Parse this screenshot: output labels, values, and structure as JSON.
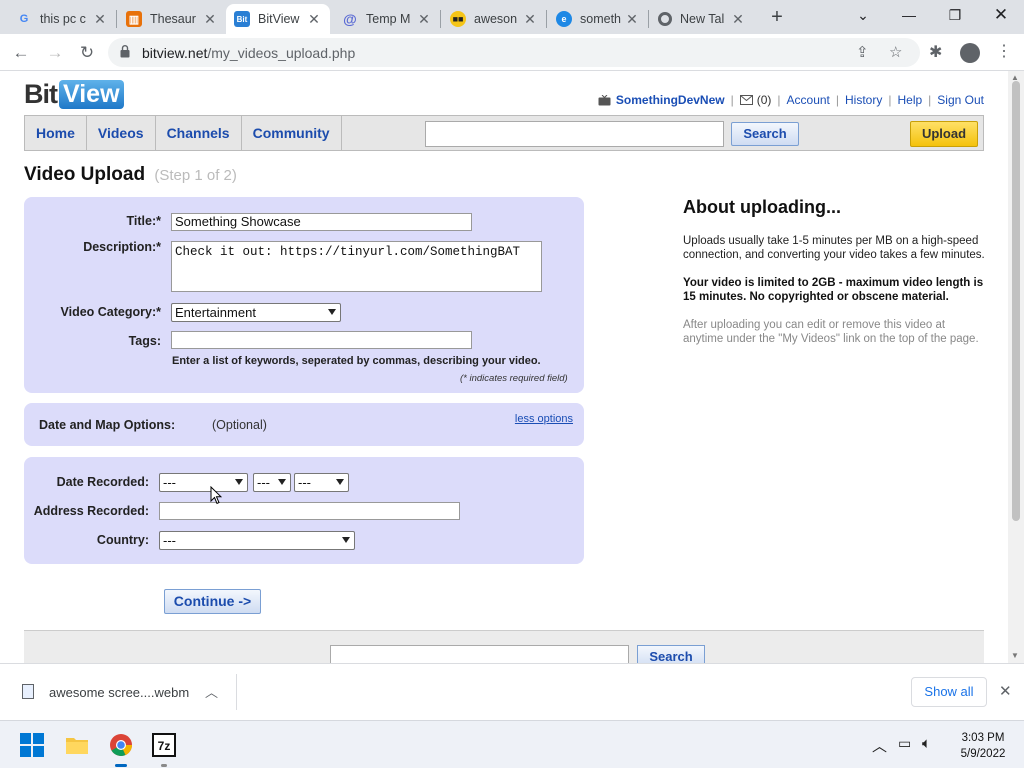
{
  "browser": {
    "tabs": [
      {
        "title": "this pc c",
        "favicon": "google-icon",
        "active": false
      },
      {
        "title": "Thesaur",
        "favicon": "book-icon",
        "active": false
      },
      {
        "title": "BitView",
        "favicon": "bitview-icon",
        "active": true
      },
      {
        "title": "Temp M",
        "favicon": "at-icon",
        "active": false
      },
      {
        "title": "aweson",
        "favicon": "sunglasses-emoji-icon",
        "active": false
      },
      {
        "title": "someth",
        "favicon": "edge-icon",
        "active": false
      },
      {
        "title": "New Tal",
        "favicon": "chrome-icon",
        "active": false
      }
    ],
    "url_host": "bitview.net",
    "url_path": "/my_videos_upload.php"
  },
  "site": {
    "logo_left": "Bit",
    "logo_right": "View",
    "user": {
      "username": "SomethingDevNew",
      "inbox_count": "(0)",
      "links": [
        "Account",
        "History",
        "Help",
        "Sign Out"
      ]
    },
    "nav": [
      "Home",
      "Videos",
      "Channels",
      "Community"
    ],
    "search_button": "Search",
    "upload_button": "Upload"
  },
  "form": {
    "page_title": "Video Upload",
    "step": "(Step 1 of 2)",
    "title_label": "Title:*",
    "title_value": "Something Showcase",
    "description_label": "Description:*",
    "description_value": "Check it out: https://tinyurl.com/SomethingBAT",
    "category_label": "Video Category:*",
    "category_value": "Entertainment",
    "tags_label": "Tags:",
    "tags_value": "",
    "tags_hint": "Enter a list of keywords, seperated by commas, describing your video.",
    "required_note": "(* indicates required field)",
    "date_map_label": "Date and Map Options:",
    "optional_text": "(Optional)",
    "less_options": "less options",
    "date_recorded_label": "Date Recorded:",
    "date_month": "---",
    "date_day": "---",
    "date_year": "---",
    "address_label": "Address Recorded:",
    "address_value": "",
    "country_label": "Country:",
    "country_value": "---",
    "continue_button": "Continue ->"
  },
  "about": {
    "heading": "About uploading...",
    "p1": "Uploads usually take 1-5 minutes per MB on a high-speed connection, and converting your video takes a few minutes.",
    "p2": "Your video is limited to 2GB - maximum video length is 15 minutes. No copyrighted or obscene material.",
    "p3": "After uploading you can edit or remove this video at anytime under the \"My Videos\" link on the top of the page."
  },
  "footer": {
    "search_button": "Search"
  },
  "download_shelf": {
    "filename": "awesome scree....webm",
    "show_all": "Show all"
  },
  "taskbar": {
    "time": "3:03 PM",
    "date": "5/9/2022"
  }
}
